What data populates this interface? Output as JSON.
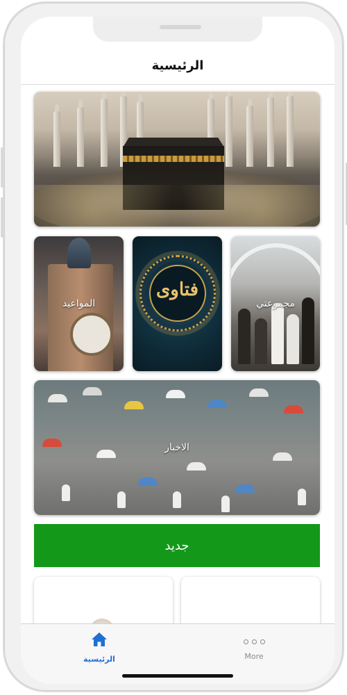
{
  "header": {
    "title": "الرئيسية"
  },
  "tiles": {
    "appointments": {
      "label": "المواعيد"
    },
    "fatawa": {
      "label": "فتاوى"
    },
    "my_group": {
      "label": "مجموعتي"
    },
    "news": {
      "label": "الاخبار"
    }
  },
  "actions": {
    "new_label": "جديد"
  },
  "tabbar": {
    "home_label": "الرئيسية",
    "more_label": "More"
  },
  "colors": {
    "accent_green": "#14981a",
    "tab_active": "#1f6fd6",
    "tab_inactive": "#8a8a8a"
  },
  "icons": {
    "home": "house-icon",
    "more": "ellipsis-icon"
  }
}
